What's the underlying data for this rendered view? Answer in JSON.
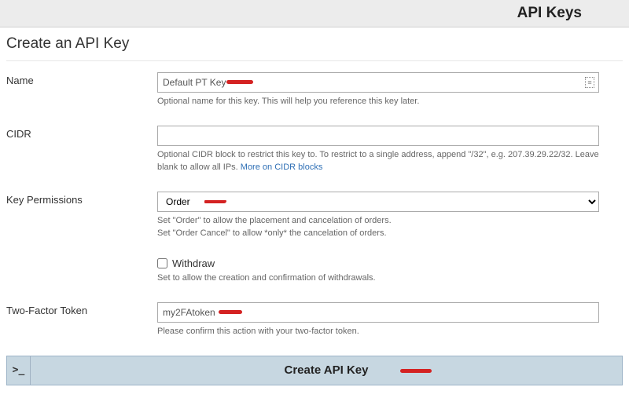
{
  "header": {
    "title": "API Keys"
  },
  "page": {
    "title": "Create an API Key"
  },
  "fields": {
    "name": {
      "label": "Name",
      "value": "Default PT Key",
      "help": "Optional name for this key. This will help you reference this key later."
    },
    "cidr": {
      "label": "CIDR",
      "value": "",
      "help_pre": "Optional CIDR block to restrict this key to. To restrict to a single address, append \"/32\", e.g. 207.39.29.22/32. Leave blank to allow all IPs. ",
      "help_link": "More on CIDR blocks"
    },
    "permissions": {
      "label": "Key Permissions",
      "value": "Order",
      "help_line1": "Set \"Order\" to allow the placement and cancelation of orders.",
      "help_line2": "Set \"Order Cancel\" to allow *only* the cancelation of orders."
    },
    "withdraw": {
      "label": "Withdraw",
      "help": "Set to allow the creation and confirmation of withdrawals."
    },
    "twofa": {
      "label": "Two-Factor Token",
      "value": "my2FAtoken",
      "help": "Please confirm this action with your two-factor token."
    }
  },
  "submit": {
    "prompt": ">_",
    "label": "Create API Key"
  }
}
